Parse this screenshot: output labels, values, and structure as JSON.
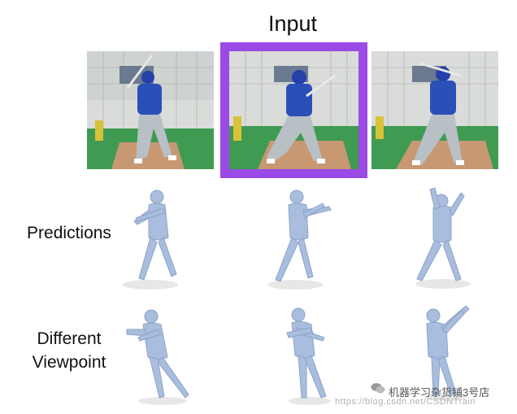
{
  "title": "Input",
  "rows": {
    "predictions_label": "Predictions",
    "viewpoint_label_line1": "Different",
    "viewpoint_label_line2": "Viewpoint"
  },
  "watermark": {
    "text": "机器学习杂货铺3号店",
    "url": "https://blog.csdn.net/CSDNTrain"
  },
  "colors": {
    "highlight": "#9a4be6",
    "mesh": "#a9bede",
    "field_green": "#3f9a52",
    "dirt": "#c79872",
    "jersey": "#2a4fb8"
  }
}
